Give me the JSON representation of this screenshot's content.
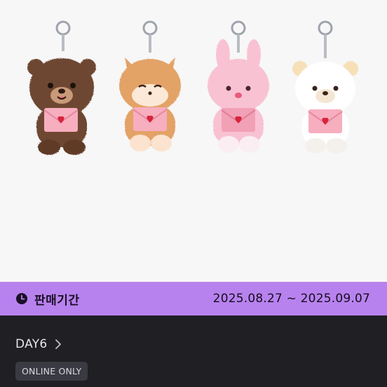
{
  "product": {
    "image_icons": [
      "brown-bear-keyring-icon",
      "fox-keyring-icon",
      "pink-bunny-keyring-icon",
      "white-bear-keyring-icon"
    ]
  },
  "sale_period": {
    "icon": "clock-icon",
    "label": "판매기간",
    "dates": "2025.08.27 ~ 2025.09.07",
    "bar_color": "#b882ee"
  },
  "info": {
    "artist": "DAY6",
    "artist_chevron_icon": "chevron-right-icon",
    "badge": "ONLINE ONLY"
  }
}
